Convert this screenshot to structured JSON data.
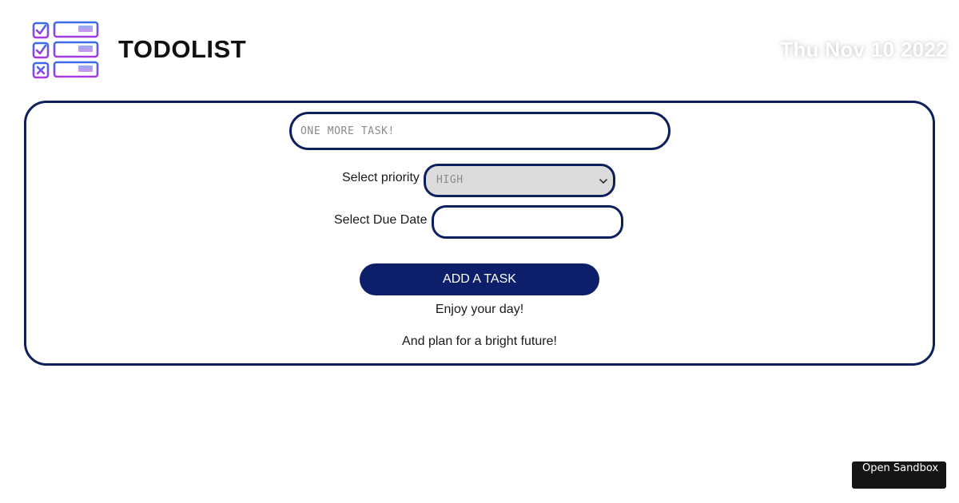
{
  "header": {
    "logo_icon": "checklist-icon",
    "title": "TODOLIST",
    "date": "Thu Nov 10 2022"
  },
  "form": {
    "task_input": {
      "value": "",
      "placeholder": "ONE MORE TASK!"
    },
    "priority": {
      "label": "Select priority",
      "selected": "HIGH"
    },
    "due_date": {
      "label": "Select Due Date",
      "value": ""
    },
    "add_button_label": "ADD A TASK"
  },
  "messages": {
    "line1": "Enjoy your day!",
    "line2": "And plan for a bright future!"
  },
  "sandbox": {
    "label": "Open Sandbox"
  },
  "colors": {
    "accent": "#0d1f6b",
    "border": "#0d1f5c",
    "logo_blue": "#3b6bea",
    "logo_purple": "#a63be0"
  }
}
